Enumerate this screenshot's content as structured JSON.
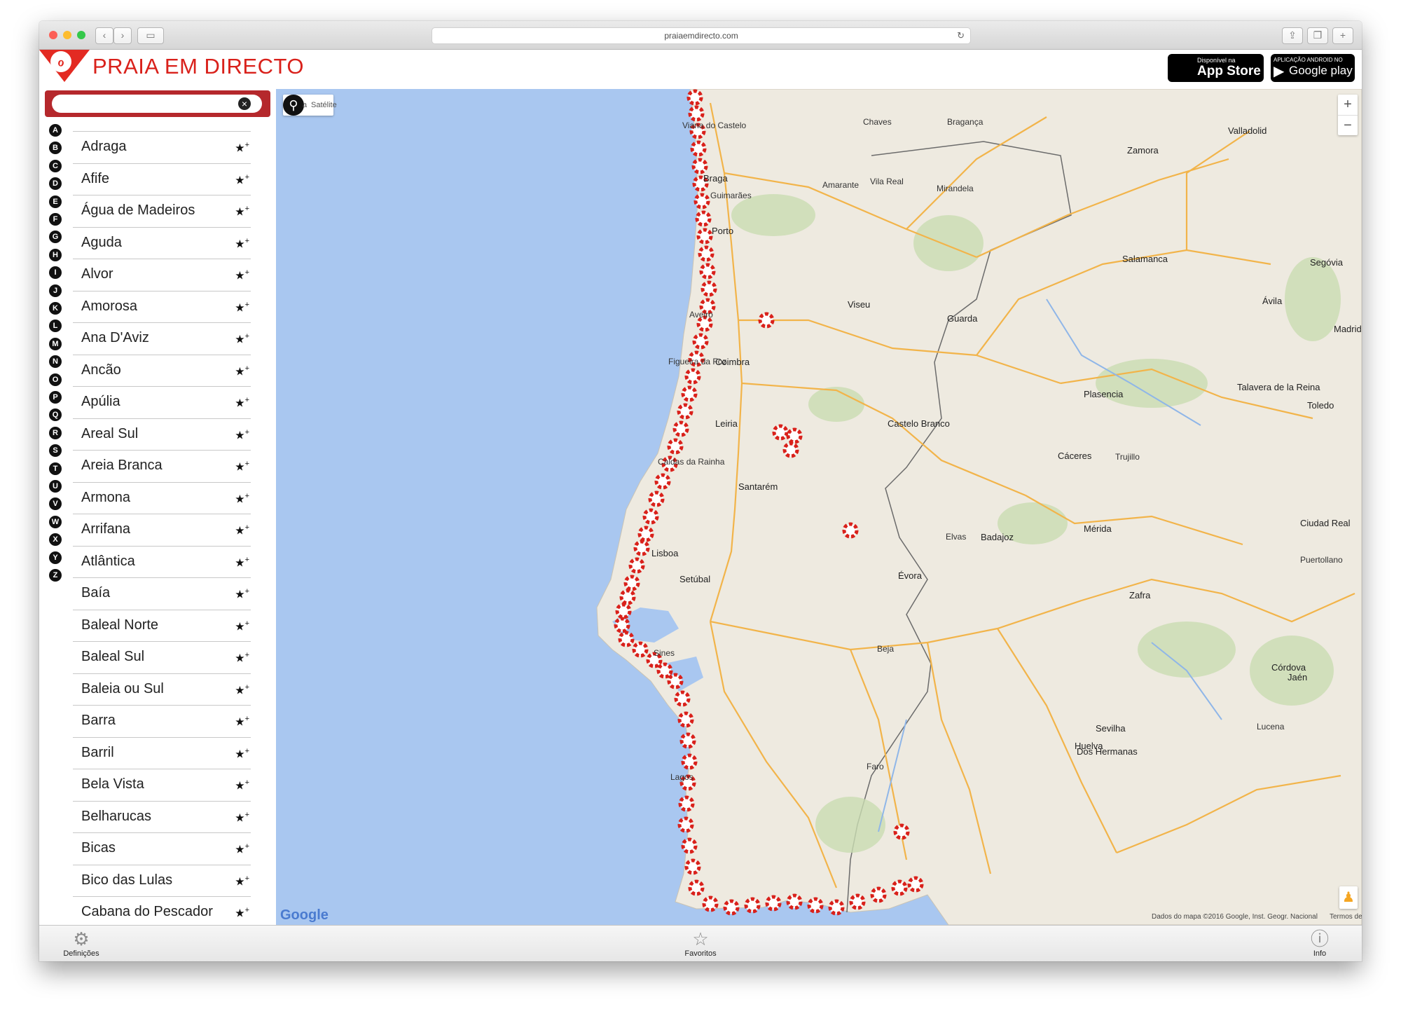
{
  "browser": {
    "url": "praiaemdirecto.com"
  },
  "header": {
    "title": "PRAIA EM DIRECTO",
    "app_store": {
      "top": "Disponível na",
      "name": "App Store"
    },
    "google_play": {
      "top": "APLICAÇÃO ANDROID NO",
      "name": "Google play"
    }
  },
  "sidebar": {
    "search": {
      "value": "",
      "placeholder": ""
    },
    "alphabet": [
      "A",
      "B",
      "C",
      "D",
      "E",
      "F",
      "G",
      "H",
      "I",
      "J",
      "K",
      "L",
      "M",
      "N",
      "O",
      "P",
      "Q",
      "R",
      "S",
      "T",
      "U",
      "V",
      "W",
      "X",
      "Y",
      "Z"
    ],
    "beaches": [
      "Adraga",
      "Afife",
      "Água de Madeiros",
      "Aguda",
      "Alvor",
      "Amorosa",
      "Ana D'Aviz",
      "Ancão",
      "Apúlia",
      "Areal Sul",
      "Areia Branca",
      "Armona",
      "Arrifana",
      "Atlântica",
      "Baía",
      "Baleal Norte",
      "Baleal Sul",
      "Baleia ou Sul",
      "Barra",
      "Barril",
      "Bela Vista",
      "Belharucas",
      "Bicas",
      "Bico das Lulas",
      "Cabana do Pescador"
    ]
  },
  "map": {
    "type_map": "a",
    "type_satellite": "Satélite",
    "zoom_in": "+",
    "zoom_out": "−",
    "google": "Google",
    "attribution": "Dados do mapa ©2016 Google, Inst. Geogr. Nacional",
    "terms": "Termos de Utilização",
    "colors": {
      "sea": "#a9c7f0",
      "land": "#eeeae0",
      "road": "#f2b44a",
      "beach_marker": "#d9211b"
    },
    "labels": [
      {
        "t": "Viana do Castelo"
      },
      {
        "t": "Braga"
      },
      {
        "t": "Chaves"
      },
      {
        "t": "Bragança"
      },
      {
        "t": "Guimarães"
      },
      {
        "t": "Vila Real"
      },
      {
        "t": "Amarante"
      },
      {
        "t": "Porto"
      },
      {
        "t": "Mirandela"
      },
      {
        "t": "Zamora"
      },
      {
        "t": "Valladolid"
      },
      {
        "t": "Aveiro"
      },
      {
        "t": "Viseu"
      },
      {
        "t": "Guarda"
      },
      {
        "t": "Salamanca"
      },
      {
        "t": "Segóvia"
      },
      {
        "t": "Ávila"
      },
      {
        "t": "Coimbra"
      },
      {
        "t": "Figueira da Foz"
      },
      {
        "t": "Leiria"
      },
      {
        "t": "Castelo Branco"
      },
      {
        "t": "Plasencia"
      },
      {
        "t": "Talavera de la Reina"
      },
      {
        "t": "Toledo"
      },
      {
        "t": "Caldas da Rainha"
      },
      {
        "t": "Santarém"
      },
      {
        "t": "Cáceres"
      },
      {
        "t": "Trujillo"
      },
      {
        "t": "Lisboa"
      },
      {
        "t": "Setúbal"
      },
      {
        "t": "Évora"
      },
      {
        "t": "Badajoz"
      },
      {
        "t": "Elvas"
      },
      {
        "t": "Mérida"
      },
      {
        "t": "Ciudad Real"
      },
      {
        "t": "Beja"
      },
      {
        "t": "Zafra"
      },
      {
        "t": "Córdova"
      },
      {
        "t": "Sines"
      },
      {
        "t": "Sevilha"
      },
      {
        "t": "Huelva"
      },
      {
        "t": "Faro"
      },
      {
        "t": "Lagos"
      },
      {
        "t": "Jaén"
      },
      {
        "t": "Lucena"
      },
      {
        "t": "Dos Hermanas"
      },
      {
        "t": "Puertollano"
      },
      {
        "t": "Madrid"
      }
    ]
  },
  "tabbar": {
    "settings": "Definições",
    "favorites": "Favoritos",
    "info": "Info"
  }
}
